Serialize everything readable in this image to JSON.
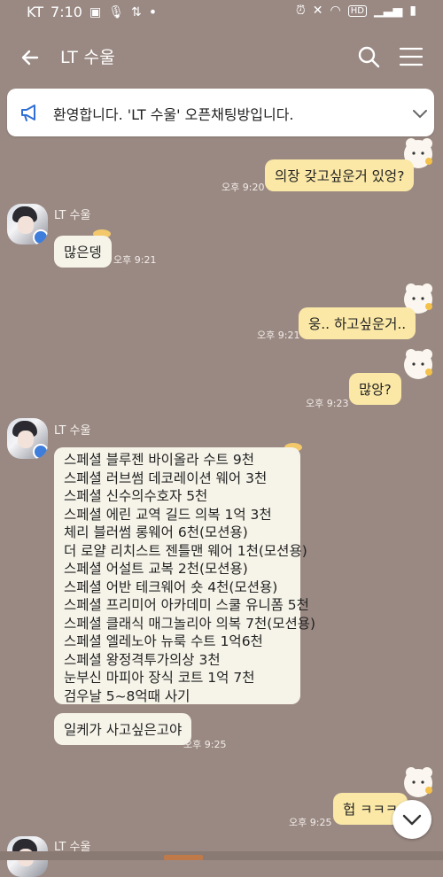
{
  "status_bar": {
    "carrier": "KT",
    "time": "7:10",
    "dot": "•",
    "right_icons": [
      "alarm-icon",
      "mute-icon",
      "wifi-icon",
      "hd-icon",
      "signal-icon",
      "battery-icon"
    ],
    "hd_label": "HD"
  },
  "header": {
    "title": "LT 수울"
  },
  "notice": {
    "text": "환영합니다. 'LT 수울' 오픈채팅방입니다."
  },
  "messages": [
    {
      "side": "out",
      "text": "의장 갖고싶운거 있엉?",
      "time": "오후 9:20"
    },
    {
      "side": "in",
      "sender": "LT 수울",
      "text": "많은뎅",
      "time": "오후 9:21"
    },
    {
      "side": "out",
      "text": "웅.. 하고싶운거..",
      "time": "오후 9:21"
    },
    {
      "side": "out",
      "text": "많앙?",
      "time": "오후 9:23"
    },
    {
      "side": "in",
      "sender": "LT 수울",
      "lines": [
        "스페셜 블루젠 바이올라 수트 9천",
        "스페셜 러브썸 데코레이션 웨어 3천",
        "스페셜 신수의수호자 5천",
        "스페셜 에린 교역 길드 의복 1억 3천",
        "체리 블러썸 롱웨어 6천(모션용)",
        "더 로얄 리치스트 젠틀맨 웨어 1천(모션용)",
        "스페셜 어설트 교복 2천(모션용)",
        "스페셜 어반 테크웨어 숏 4천(모션용)",
        "스페셜 프리미어 아카데미 스쿨 유니폼 5천",
        "스페셜 클래식 매그놀리아 의복 7천(모션용)",
        "스페셜 엘레노아 뉴룩 수트 1억6천",
        "스페셜 왕정격투가의상 3천",
        "눈부신 마피아 장식 코트 1억 7천",
        "검우날 5~8억때 사기"
      ]
    },
    {
      "side": "in",
      "text": "일케가 사고싶은고야",
      "time": "오후 9:25"
    },
    {
      "side": "out",
      "text": "헙 ㅋㅋㅋ",
      "time": "오후 9:25"
    },
    {
      "side": "in",
      "sender": "LT 수울"
    }
  ],
  "colors": {
    "background": "#9a8983",
    "outgoing_bubble": "#fbe8a6",
    "incoming_bubble": "#f6f4e9",
    "badge": "#3d7ddb"
  }
}
